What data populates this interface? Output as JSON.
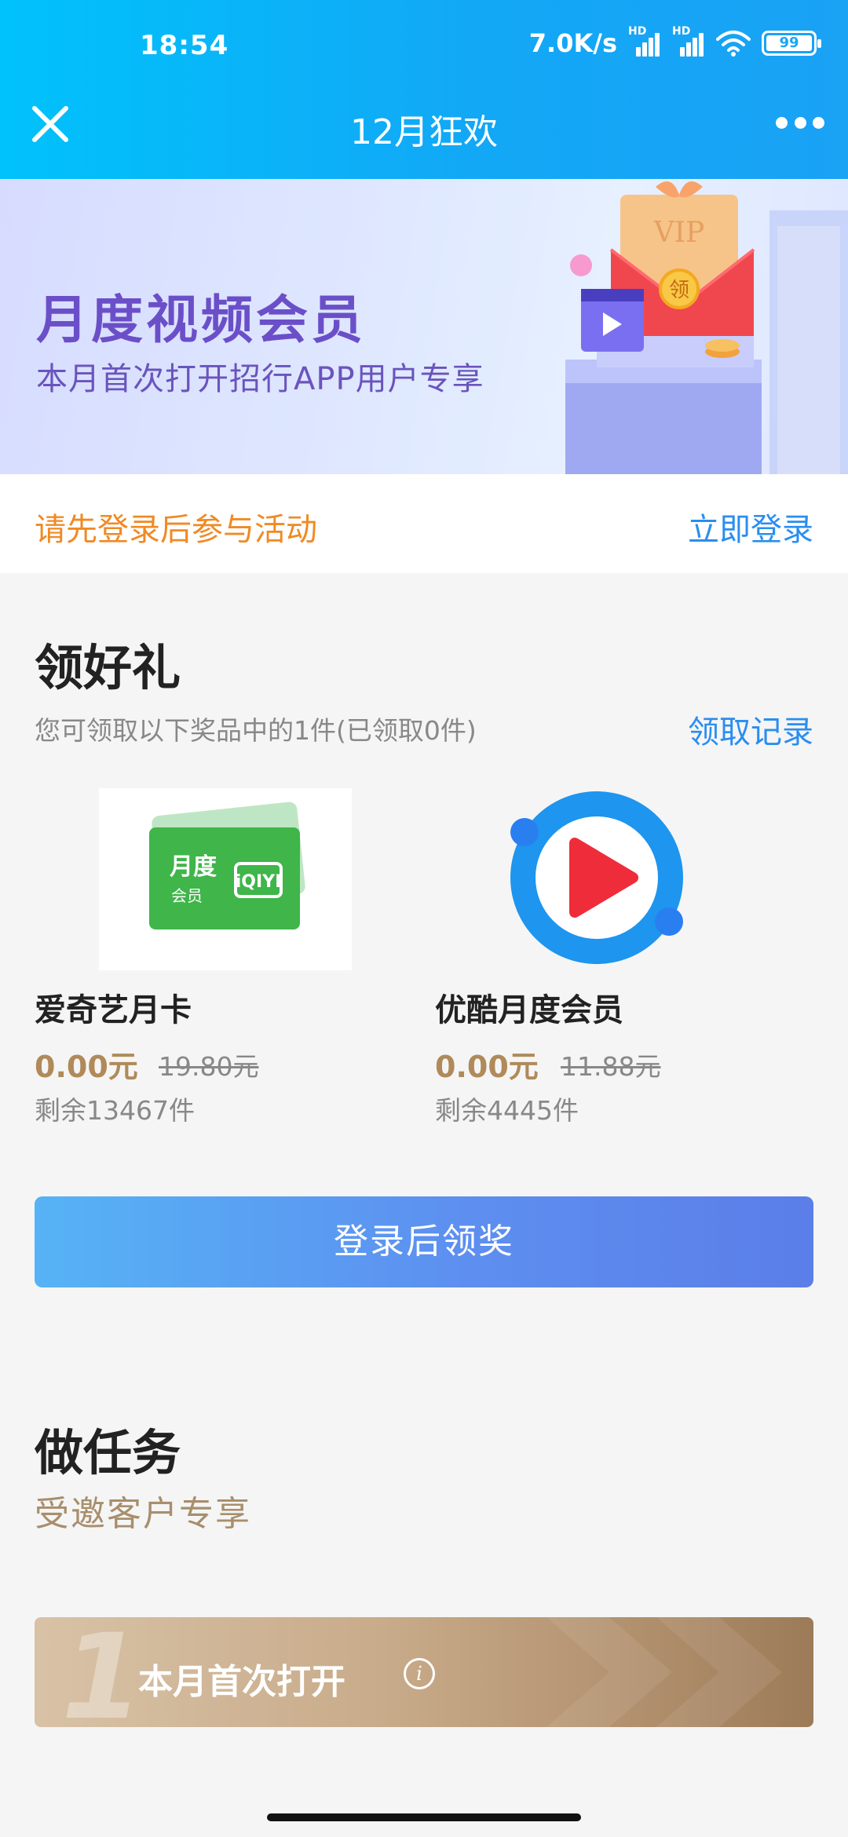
{
  "status_bar": {
    "time": "18:54",
    "net_speed": "7.0K/s",
    "hd1": "HD",
    "hd2": "HD",
    "battery": "99"
  },
  "nav": {
    "title": "12月狂欢"
  },
  "banner": {
    "title": "月度视频会员",
    "subtitle": "本月首次打开招行APP用户专享",
    "art_vip": "VIP",
    "art_seal": "领"
  },
  "login_row": {
    "hint": "请先登录后参与活动",
    "link": "立即登录"
  },
  "gifts": {
    "title": "领好礼",
    "subtitle": "您可领取以下奖品中的1件(已领取0件)",
    "record_link": "领取记录",
    "items": [
      {
        "name": "爱奇艺月卡",
        "price": "0.00元",
        "original": "19.80元",
        "remaining": "剩余13467件",
        "card_line1": "月度",
        "card_line2": "会员",
        "card_brand": "iQIYI"
      },
      {
        "name": "优酷月度会员",
        "price": "0.00元",
        "original": "11.88元",
        "remaining": "剩余4445件"
      }
    ],
    "claim_button": "登录后领奖"
  },
  "tasks": {
    "title": "做任务",
    "subtitle": "受邀客户专享",
    "items": [
      {
        "number": "1",
        "label": "本月首次打开",
        "info_icon": "i"
      }
    ]
  },
  "colors": {
    "header_blue": "#12a8f6",
    "accent_orange": "#f08a24",
    "link_blue": "#2a8ef0",
    "price_gold": "#b08a5a",
    "banner_purple": "#6b4fc8"
  },
  "icons": [
    "close-icon",
    "more-icon",
    "wifi-icon",
    "signal-icon",
    "battery-icon",
    "info-icon",
    "youku-play-icon"
  ]
}
